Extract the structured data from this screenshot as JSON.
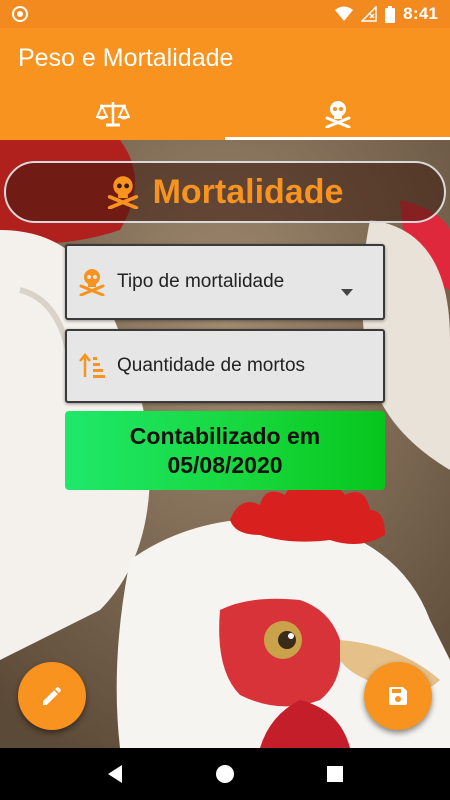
{
  "status_bar": {
    "time": "8:41",
    "icons": [
      "circle-notification-icon",
      "wifi-icon",
      "signal-off-icon",
      "battery-icon"
    ]
  },
  "app_bar": {
    "title": "Peso e Mortalidade"
  },
  "tabs": [
    {
      "icon": "scale-icon",
      "selected": false
    },
    {
      "icon": "skull-crossbones-icon",
      "selected": true
    }
  ],
  "header": {
    "title": "Mortalidade",
    "icon": "skull-crossbones-icon"
  },
  "form": {
    "mortality_type_placeholder": "Tipo de mortalidade",
    "dead_quantity_placeholder": "Quantidade de mortos"
  },
  "accounted": {
    "line1": "Contabilizado em",
    "line2": "05/08/2020"
  },
  "fab": {
    "edit_icon": "pencil-icon",
    "save_icon": "save-icon"
  },
  "nav_bar": {
    "icons": [
      "back-icon",
      "home-icon",
      "recents-icon"
    ]
  },
  "colors": {
    "primary": "#f7931e",
    "status_bar": "#f28a1f",
    "accent_green": "#16d63a",
    "card_bg": "#e6e6e6"
  }
}
